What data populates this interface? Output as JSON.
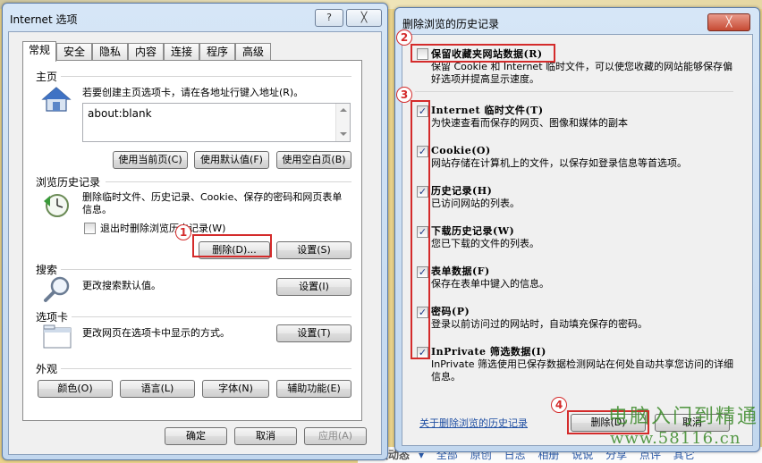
{
  "left": {
    "title": "Internet 选项",
    "help": "?",
    "close": "╳",
    "tabs": [
      "常规",
      "安全",
      "隐私",
      "内容",
      "连接",
      "程序",
      "高级"
    ],
    "home": {
      "heading": "主页",
      "desc": "若要创建主页选项卡，请在各地址行键入地址(R)。",
      "url": "about:blank",
      "btn_current": "使用当前页(C)",
      "btn_default": "使用默认值(F)",
      "btn_blank": "使用空白页(B)"
    },
    "history": {
      "heading": "浏览历史记录",
      "desc": "删除临时文件、历史记录、Cookie、保存的密码和网页表单信息。",
      "exit_check": "退出时删除浏览历史记录(W)",
      "btn_delete": "删除(D)...",
      "btn_settings": "设置(S)"
    },
    "search": {
      "heading": "搜索",
      "desc": "更改搜索默认值。",
      "btn_settings": "设置(I)"
    },
    "tabsect": {
      "heading": "选项卡",
      "desc": "更改网页在选项卡中显示的方式。",
      "btn_settings": "设置(T)"
    },
    "appearance": {
      "heading": "外观",
      "btn_colors": "颜色(O)",
      "btn_languages": "语言(L)",
      "btn_fonts": "字体(N)",
      "btn_access": "辅助功能(E)"
    },
    "btn_ok": "确定",
    "btn_cancel": "取消",
    "btn_apply": "应用(A)"
  },
  "right": {
    "title": "删除浏览的历史记录",
    "close": "╳",
    "preserve": {
      "label": "保留收藏夹网站数据(R)",
      "desc": "保留 Cookie 和 Internet 临时文件，可以使您收藏的网站能够保存偏好选项并提高显示速度。",
      "checked": false
    },
    "items": [
      {
        "label": "Internet 临时文件(T)",
        "desc": "为快速查看而保存的网页、图像和媒体的副本"
      },
      {
        "label": "Cookie(O)",
        "desc": "网站存储在计算机上的文件，以保存如登录信息等首选项。"
      },
      {
        "label": "历史记录(H)",
        "desc": "已访问网站的列表。"
      },
      {
        "label": "下载历史记录(W)",
        "desc": "您已下载的文件的列表。"
      },
      {
        "label": "表单数据(F)",
        "desc": "保存在表单中键入的信息。"
      },
      {
        "label": "密码(P)",
        "desc": "登录以前访问过的网站时，自动填充保存的密码。"
      },
      {
        "label": "InPrivate 筛选数据(I)",
        "desc": "InPrivate 筛选使用已保存数据检测网站在何处自动共享您访问的详细信息。"
      }
    ],
    "check_mark": "✓",
    "about_link": "关于删除浏览的历史记录",
    "btn_delete": "删除(D)",
    "btn_cancel": "取消"
  },
  "annotations": [
    "1",
    "2",
    "3",
    "4"
  ],
  "watermark": {
    "line1": "电脑入门到精通",
    "line2": "www.58116.cn"
  },
  "bottom_nav": {
    "title": "好友动态",
    "arrow": "▾",
    "items": [
      "全部",
      "原创",
      "日志",
      "相册",
      "说说",
      "分享",
      "点评",
      "其它"
    ]
  },
  "colors": {
    "annotation": "#d42b2b",
    "link": "#1f4fa3",
    "watermark": "#3c8a2a"
  }
}
